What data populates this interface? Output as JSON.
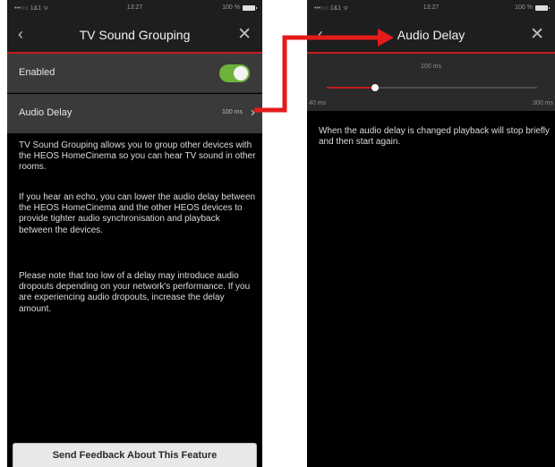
{
  "colors": {
    "accent": "#c71c1c",
    "toggle_on": "#6fb23a",
    "row_bg": "#3a3a3a",
    "screen_bg": "#000000",
    "bar_bg": "#1e1e1e"
  },
  "left_screen": {
    "status": {
      "signal": "•••○○ 1&1 ᯤ",
      "time": "13:27",
      "battery": "100 %"
    },
    "nav": {
      "back_icon": "chevron-left-icon",
      "title": "TV Sound Grouping",
      "close_icon": "close-icon"
    },
    "enabled_row": {
      "label": "Enabled",
      "toggle_on": true
    },
    "audio_delay_row": {
      "label": "Audio Delay",
      "value": "100 ms",
      "chevron_icon": "chevron-right-icon"
    },
    "paragraphs": [
      "TV Sound Grouping allows you to group other devices with the HEOS HomeCinema so you can hear TV sound in other rooms.",
      "If you hear an echo, you can lower the audio delay between the HEOS HomeCinema and the other HEOS devices to provide tighter audio synchronisation and playback between the devices.",
      "Please note that too low of a delay may introduce audio dropouts depending on your network's performance. If you are experiencing audio dropouts, increase the delay amount."
    ],
    "feedback_button": "Send Feedback About This Feature"
  },
  "right_screen": {
    "status": {
      "signal": "•••○○ 1&1 ᯤ",
      "time": "13:27",
      "battery": "100 %"
    },
    "nav": {
      "back_icon": "chevron-left-icon",
      "title": "Audio Delay",
      "close_icon": "close-icon"
    },
    "slider": {
      "current": "100 ms",
      "min_label": "40 ms",
      "max_label": "300 ms",
      "min": 40,
      "max": 300,
      "value": 100
    },
    "note": "When the audio delay is changed playback will stop briefly and then start again."
  }
}
